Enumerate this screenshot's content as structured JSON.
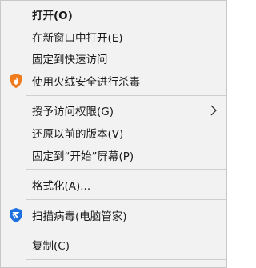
{
  "context_menu": {
    "items": [
      {
        "label": "打开(O)"
      },
      {
        "label": "在新窗口中打开(E)"
      },
      {
        "label": "固定到快速访问"
      },
      {
        "label": "使用火绒安全进行杀毒",
        "icon": "huorong-shield-icon"
      },
      {
        "label": "授予访问权限(G)",
        "submenu": true
      },
      {
        "label": "还原以前的版本(V)"
      },
      {
        "label": "固定到“开始”屏幕(P)"
      },
      {
        "label": "格式化(A)..."
      },
      {
        "label": "扫描病毒(电脑管家)",
        "icon": "tencent-pcmgr-shield-icon"
      },
      {
        "label": "复制(C)"
      }
    ]
  },
  "colors": {
    "menu_background": "#f2f2f2",
    "separator": "#cfcfcf",
    "huorong_orange": "#f07b1d",
    "pcmgr_blue": "#1e6fe0"
  }
}
